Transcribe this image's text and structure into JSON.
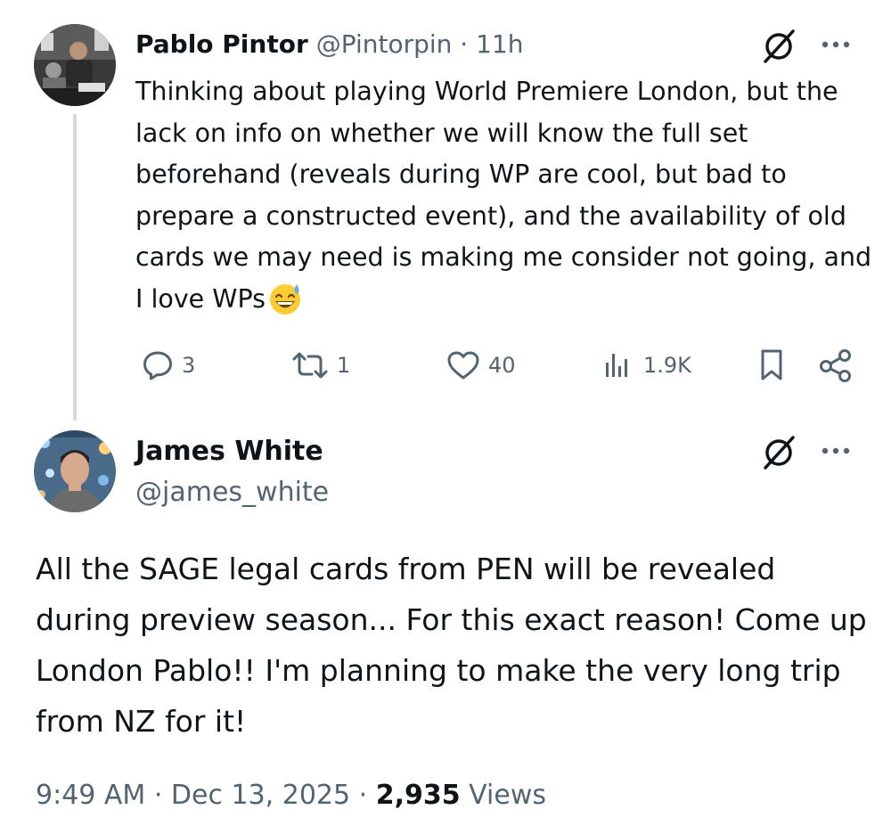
{
  "tweet1": {
    "name": "Pablo Pintor",
    "handle": "@Pintorpin",
    "separator": " · ",
    "time": "11h",
    "text": "Thinking about playing World Premiere London, but the lack on info on whether we will know the full set beforehand (reveals during WP are cool, but bad to prepare a constructed event), and the availability of old cards we may need is making me consider not going, and I love WPs",
    "emoji": "grinning-sweat-emoji",
    "stats": {
      "replies": "3",
      "reposts": "1",
      "likes": "40",
      "views": "1.9K"
    }
  },
  "tweet2": {
    "name": "James White",
    "handle": "@james_white",
    "text": "All the SAGE legal cards from PEN will be revealed during preview season... For this exact reason! Come up London Pablo!! I'm planning to make the very long  trip from NZ for it!",
    "time": "9:49 AM",
    "dot1": " · ",
    "date": "Dec 13, 2025",
    "dot2": " · ",
    "views_count": "2,935",
    "views_label": " Views"
  },
  "icons": [
    "grok-icon",
    "more-icon",
    "reply-icon",
    "repost-icon",
    "like-icon",
    "views-icon",
    "bookmark-icon",
    "share-icon"
  ],
  "colors": {
    "text": "#0f1419",
    "muted": "#536471",
    "thread_line": "#cfd9de"
  }
}
